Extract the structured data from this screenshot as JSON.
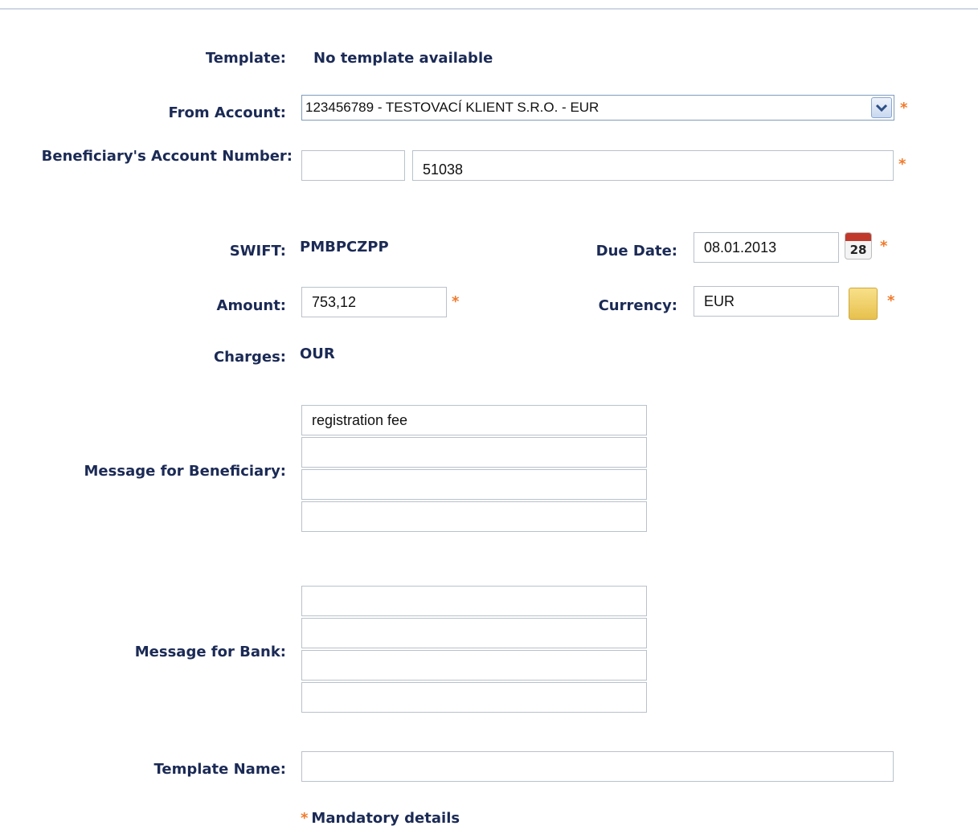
{
  "template": {
    "label": "Template:",
    "value": "No template available"
  },
  "from_account": {
    "label": "From Account:",
    "value": "123456789 - TESTOVACÍ KLIENT S.R.O. - EUR"
  },
  "beneficiary_account": {
    "label": "Beneficiary's Account Number:",
    "prefix": "",
    "number": "51038"
  },
  "swift": {
    "label": "SWIFT:",
    "value": "PMBPCZPP"
  },
  "due_date": {
    "label": "Due Date:",
    "value": "08.01.2013",
    "calendar_day": "28"
  },
  "amount": {
    "label": "Amount:",
    "value": "753,12"
  },
  "currency": {
    "label": "Currency:",
    "value": "EUR"
  },
  "charges": {
    "label": "Charges:",
    "value": "OUR"
  },
  "message_beneficiary": {
    "label": "Message for Beneficiary:",
    "lines": [
      "registration fee",
      "",
      "",
      ""
    ]
  },
  "message_bank": {
    "label": "Message for Bank:",
    "lines": [
      "",
      "",
      "",
      ""
    ]
  },
  "template_name": {
    "label": "Template Name:",
    "value": ""
  },
  "required_marker": "*",
  "mandatory_note": "Mandatory details",
  "colors": {
    "label": "#1b2a55",
    "required": "#f07a2b",
    "border": "#b9c1cc"
  }
}
